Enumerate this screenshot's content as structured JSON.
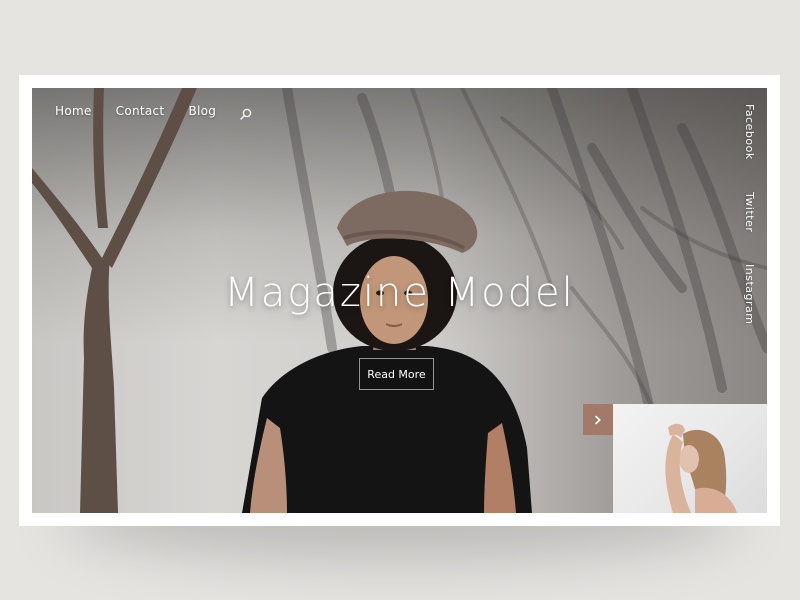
{
  "nav": {
    "items": [
      "Home",
      "Contact",
      "Blog"
    ],
    "search_icon": "search-icon"
  },
  "social": {
    "items": [
      "Facebook",
      "Twitter",
      "Instagram"
    ]
  },
  "hero": {
    "title": "Magazine Model",
    "cta_label": "Read More"
  },
  "carousel": {
    "next_icon": "chevron-right-icon",
    "accent_color": "#a27a6a"
  }
}
